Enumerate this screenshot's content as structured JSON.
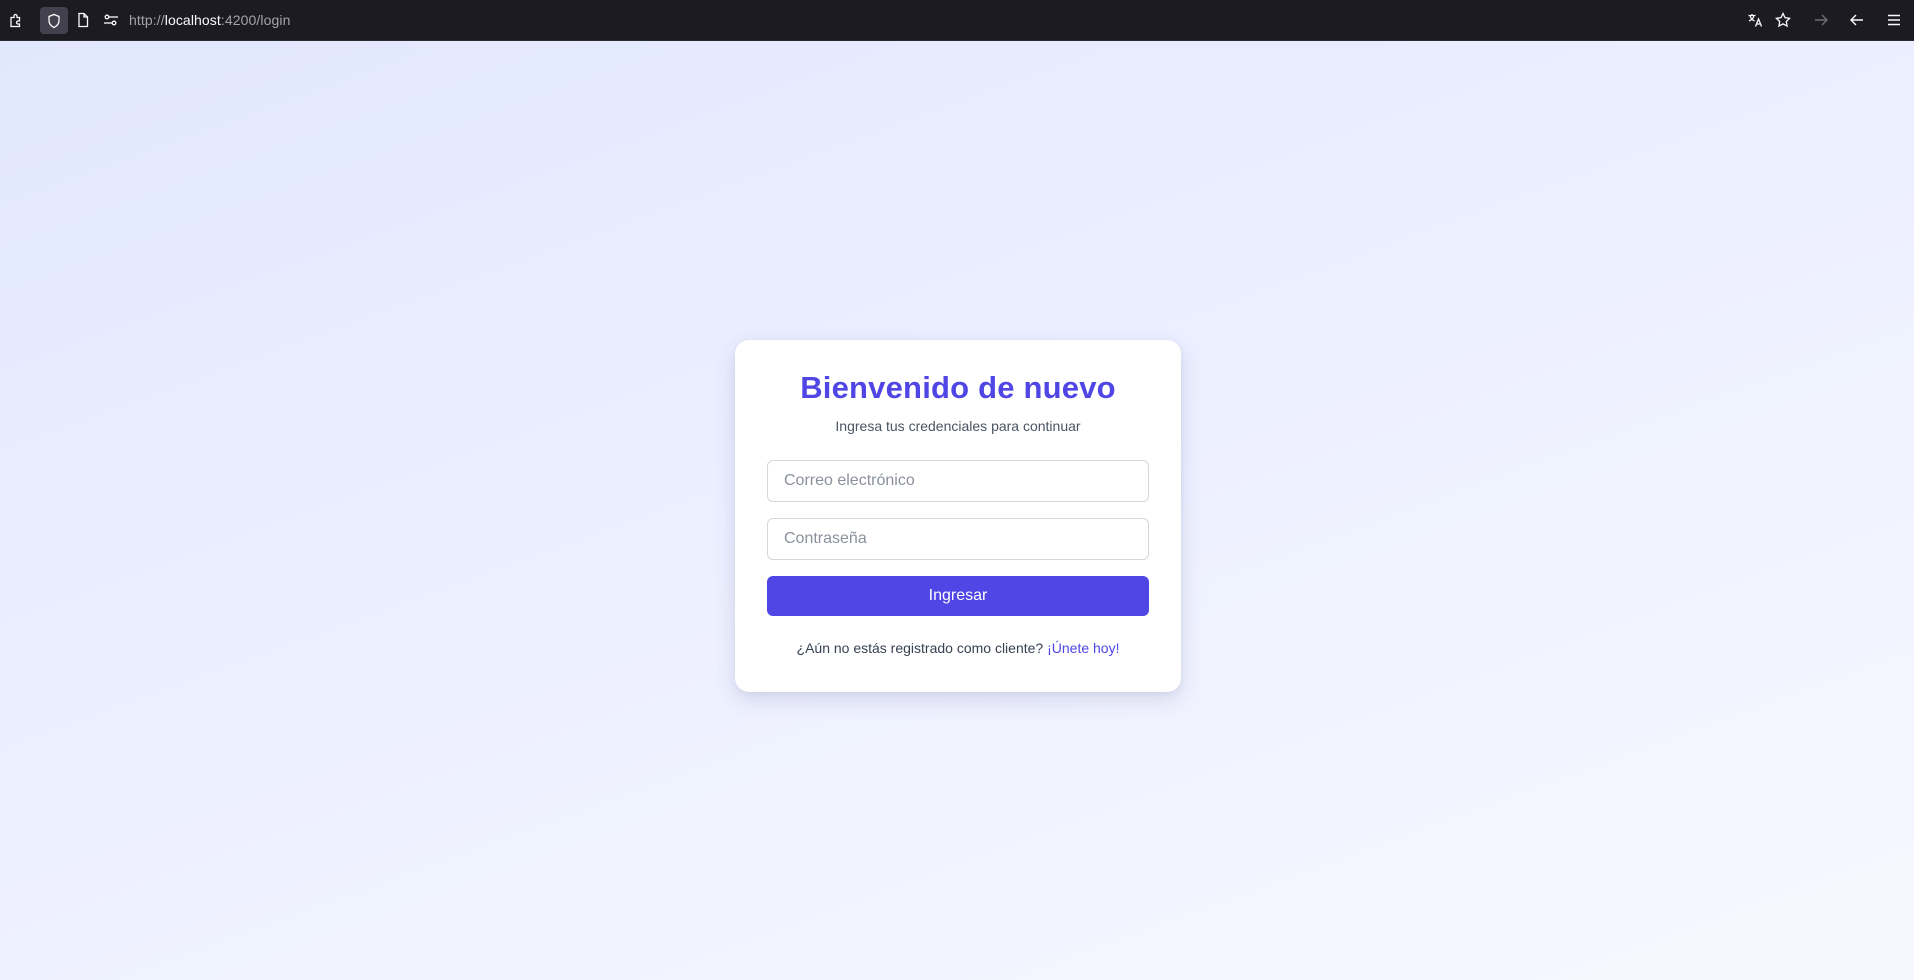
{
  "browser": {
    "url_scheme": "http://",
    "url_host": "localhost",
    "url_path": ":4200/login",
    "icons": [
      "extensions-icon",
      "shield-icon",
      "page-icon",
      "permissions-icon",
      "translate-icon",
      "bookmark-star-icon",
      "forward-icon",
      "back-icon",
      "menu-icon"
    ]
  },
  "login": {
    "title": "Bienvenido de nuevo",
    "subtitle": "Ingresa tus credenciales para continuar",
    "email_placeholder": "Correo electrónico",
    "email_value": "",
    "password_placeholder": "Contraseña",
    "password_value": "",
    "submit_label": "Ingresar",
    "register_prompt": "¿Aún no estás registrado como cliente?",
    "register_link": "¡Únete hoy!"
  },
  "colors": {
    "accent": "#4f46e5",
    "toolbar_bg": "#1c1b22",
    "page_bg_start": "#e1e7fd",
    "page_bg_end": "#f7f8ff"
  }
}
